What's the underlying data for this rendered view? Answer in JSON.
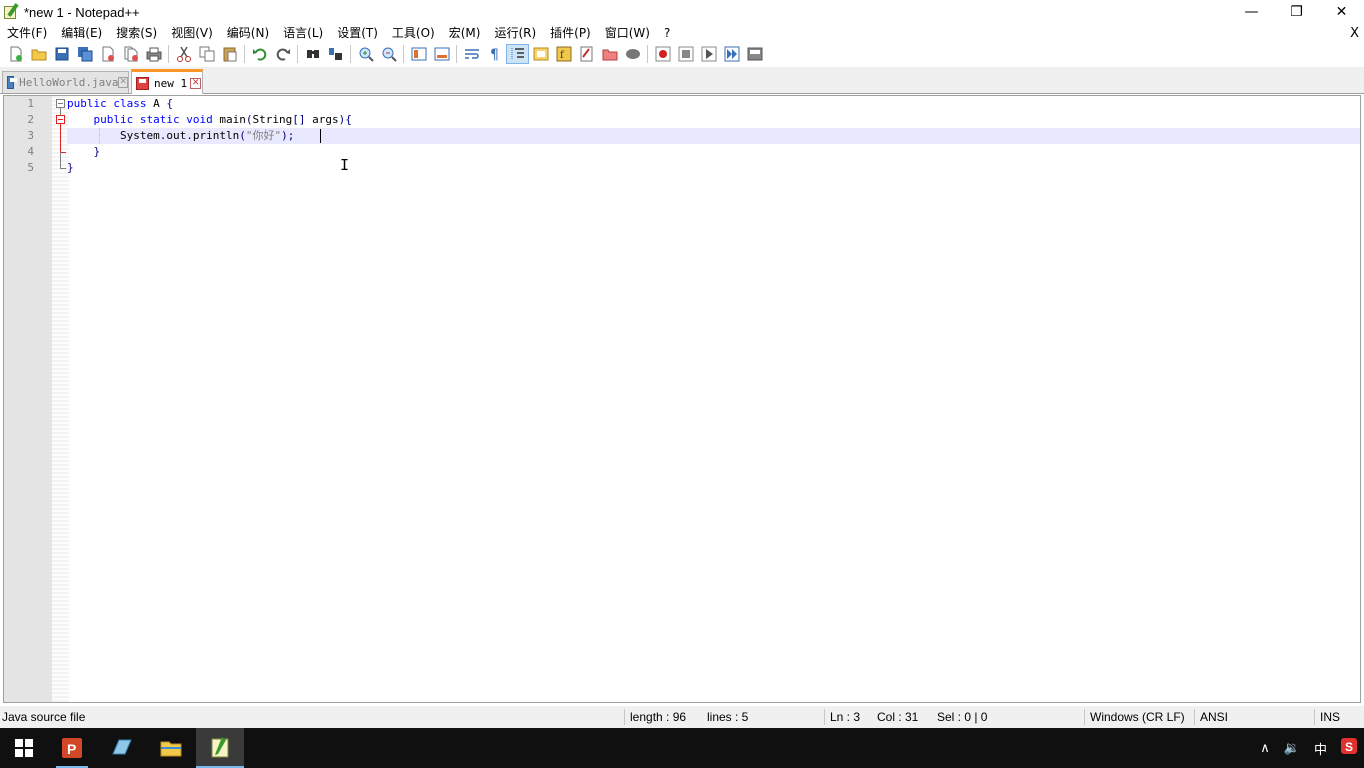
{
  "window": {
    "title": "*new 1 - Notepad++",
    "minimize": "—",
    "restore": "❐",
    "close": "✕"
  },
  "menu": {
    "items": [
      "文件(F)",
      "编辑(E)",
      "搜索(S)",
      "视图(V)",
      "编码(N)",
      "语言(L)",
      "设置(T)",
      "工具(O)",
      "宏(M)",
      "运行(R)",
      "插件(P)",
      "窗口(W)",
      "?"
    ],
    "close_doc": "X"
  },
  "toolbar": {
    "icons": [
      "new-file-icon",
      "open-file-icon",
      "save-icon",
      "save-all-icon",
      "close-icon",
      "close-all-icon",
      "print-icon",
      "cut-icon",
      "copy-icon",
      "paste-icon",
      "undo-icon",
      "redo-icon",
      "find-icon",
      "replace-icon",
      "zoom-in-icon",
      "zoom-out-icon",
      "sync-vertical-icon",
      "sync-horizontal-icon",
      "word-wrap-icon",
      "show-all-chars-icon",
      "indent-guide-icon",
      "doc-map-icon",
      "function-list-icon",
      "folder-workspace-icon",
      "monitor-icon",
      "record-macro-icon",
      "stop-record-icon",
      "play-macro-icon",
      "run-macro-multiple-icon",
      "save-macro-icon"
    ]
  },
  "tabs": [
    {
      "label": "HelloWorld.java",
      "state": "saved"
    },
    {
      "label": "new 1",
      "state": "unsaved"
    }
  ],
  "editor": {
    "lines": [
      {
        "num": "1",
        "tokens": [
          {
            "t": "public class",
            "c": "kw"
          },
          {
            "t": " A ",
            "c": "plain"
          },
          {
            "t": "{",
            "c": "op"
          }
        ]
      },
      {
        "num": "2",
        "tokens": [
          {
            "t": "    public static void",
            "c": "kw"
          },
          {
            "t": " main",
            "c": "plain"
          },
          {
            "t": "(",
            "c": "op"
          },
          {
            "t": "String",
            "c": "plain"
          },
          {
            "t": "[]",
            "c": "op"
          },
          {
            "t": " args",
            "c": "plain"
          },
          {
            "t": "){",
            "c": "op"
          }
        ]
      },
      {
        "num": "3",
        "tokens": [
          {
            "t": "        System",
            "c": "plain"
          },
          {
            "t": ".",
            "c": "op"
          },
          {
            "t": "out",
            "c": "plain"
          },
          {
            "t": ".",
            "c": "op"
          },
          {
            "t": "println",
            "c": "plain"
          },
          {
            "t": "(",
            "c": "op"
          },
          {
            "t": "\"你好\"",
            "c": "str"
          },
          {
            "t": ");",
            "c": "op"
          }
        ]
      },
      {
        "num": "4",
        "tokens": [
          {
            "t": "    }",
            "c": "op"
          }
        ]
      },
      {
        "num": "5",
        "tokens": [
          {
            "t": "}",
            "c": "op"
          }
        ]
      }
    ]
  },
  "status": {
    "filetype": "Java source file",
    "length": "length : 96",
    "lines": "lines : 5",
    "ln": "Ln : 3",
    "col": "Col : 31",
    "sel": "Sel : 0 | 0",
    "eol": "Windows (CR LF)",
    "encoding": "ANSI",
    "mode": "INS"
  },
  "taskbar": {
    "apps": [
      "start-icon",
      "powerpoint-icon",
      "app-icon",
      "file-explorer-icon",
      "notepadpp-icon"
    ],
    "tray": {
      "chevron": "∧",
      "volume": "🔉",
      "ime": "中",
      "sogou": "S"
    }
  },
  "colors": {
    "keyword": "#0000ff",
    "string": "#808080",
    "current_line": "#e8e8ff",
    "active_tab_accent": "#fa9628",
    "taskbar": "#101010"
  }
}
